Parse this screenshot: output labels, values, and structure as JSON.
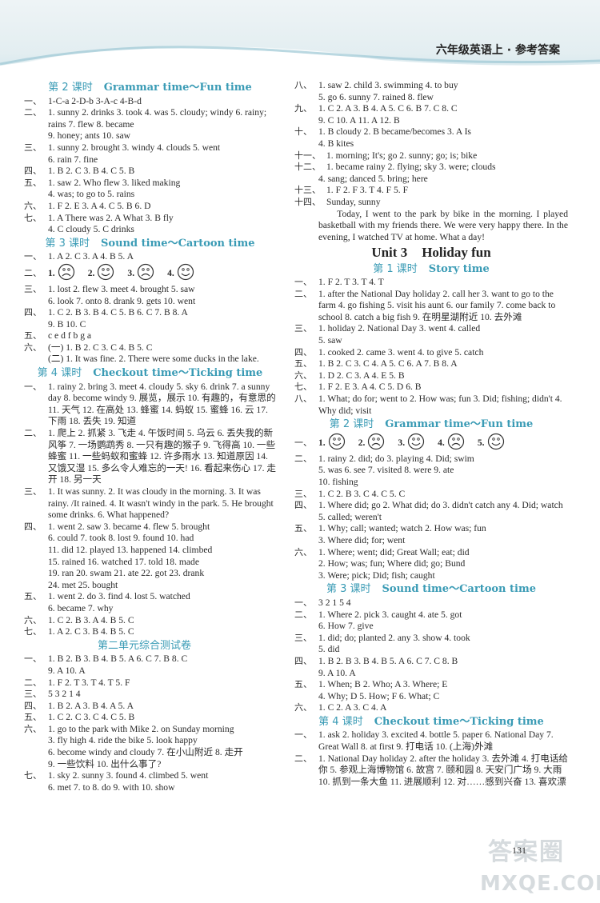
{
  "header": {
    "title": "六年级英语上 · 参考答案"
  },
  "left": [
    {
      "type": "section",
      "cn": "第 2 课时",
      "en": "Grammar time～Fun time"
    },
    {
      "pre": "一、",
      "text": "1-C-a   2-D-b   3-A-c   4-B-d"
    },
    {
      "pre": "二、",
      "text": "1. sunny   2. drinks   3. took   4. was   5. cloudy; windy   6. rainy; rains   7. flew   8. became"
    },
    {
      "pre": "",
      "text": "9. honey; ants   10. saw"
    },
    {
      "pre": "三、",
      "text": "1. sunny   2. brought   3. windy   4. clouds   5. went"
    },
    {
      "pre": "",
      "text": "6. rain   7. fine"
    },
    {
      "pre": "四、",
      "text": "1. B   2. C   3. B   4. C   5. B"
    },
    {
      "pre": "五、",
      "text": "1. saw   2. Who flew   3. liked making"
    },
    {
      "pre": "",
      "text": "4. was; to go to   5. rains"
    },
    {
      "pre": "六、",
      "text": "1. F   2. E   3. A   4. C   5. B   6. D"
    },
    {
      "pre": "七、",
      "text": "1. A   There was   2. A   What   3. B   fly"
    },
    {
      "pre": "",
      "text": "4. C   cloudy   5. C   drinks"
    },
    {
      "type": "section",
      "cn": "第 3 课时",
      "en": "Sound time～Cartoon time"
    },
    {
      "pre": "一、",
      "text": "1. A   2. C   3. A   4. B   5. A"
    },
    {
      "type": "faces",
      "pre": "二、",
      "faces": [
        {
          "n": "1.",
          "mood": "sad"
        },
        {
          "n": "2.",
          "mood": "happy"
        },
        {
          "n": "3.",
          "mood": "sad"
        },
        {
          "n": "4.",
          "mood": "happy"
        }
      ]
    },
    {
      "pre": "三、",
      "text": "1. lost   2. flew   3. meet   4. brought   5. saw"
    },
    {
      "pre": "",
      "text": "6. look   7. onto   8. drank   9. gets   10. went"
    },
    {
      "pre": "四、",
      "text": "1. C   2. B   3. B   4. C   5. B   6. C   7. B   8. A"
    },
    {
      "pre": "",
      "text": "9. B   10. C"
    },
    {
      "pre": "五、",
      "text": "c e d f b g a"
    },
    {
      "pre": "六、",
      "text": "(一) 1. B   2. C   3. C   4. B   5. C"
    },
    {
      "pre": "",
      "text": "(二) 1. It was fine.   2. There were some ducks in the lake."
    },
    {
      "type": "section",
      "cn": "第 4 课时",
      "en": "Checkout time～Ticking time"
    },
    {
      "pre": "一、",
      "text": "1. rainy   2. bring   3. meet   4. cloudy   5. sky   6. drink   7. a sunny day   8. become windy   9. 展览，展示   10. 有趣的，有意思的   11. 天气   12. 在高处   13. 蜂蜜   14. 蚂蚁   15. 蜜蜂   16. 云   17. 下雨   18. 丢失   19. 知道"
    },
    {
      "pre": "二、",
      "text": "1. 爬上   2. 抓紧   3. 飞走   4. 午饭时间   5. 乌云   6. 丢失我的新风筝   7. 一场鹦鹉秀   8. 一只有趣的猴子   9. 飞得高   10. 一些蜂蜜   11. 一些蚂蚁和蜜蜂   12. 许多雨水   13. 知道原因   14. 又饿又湿   15. 多么令人难忘的一天!   16. 看起来伤心   17. 走开   18. 另一天"
    },
    {
      "pre": "三、",
      "text": "1. It was sunny.   2. It was cloudy in the morning.   3. It was rainy. /It rained.   4. It wasn't windy in the park.   5. He brought some drinks.   6. What happened?"
    },
    {
      "pre": "四、",
      "text": "1. went   2. saw   3. became   4. flew   5. brought"
    },
    {
      "pre": "",
      "text": "6. could   7. took   8. lost   9. found   10. had"
    },
    {
      "pre": "",
      "text": "11. did   12. played   13. happened   14. climbed"
    },
    {
      "pre": "",
      "text": "15. rained   16. watched   17. told   18. made"
    },
    {
      "pre": "",
      "text": "19. ran   20. swam   21. ate   22. got   23. drank"
    },
    {
      "pre": "",
      "text": "24. met   25. bought"
    },
    {
      "pre": "五、",
      "text": "1. went   2. do   3. find   4. lost   5. watched"
    },
    {
      "pre": "",
      "text": "6. became   7. why"
    },
    {
      "pre": "六、",
      "text": "1. C   2. B   3. A   4. B   5. C"
    },
    {
      "pre": "七、",
      "text": "1. A   2. C   3. B   4. B   5. C"
    },
    {
      "type": "section",
      "cn": "第二单元综合测试卷",
      "en": ""
    },
    {
      "pre": "一、",
      "text": "1. B   2. B   3. B   4. B   5. A   6. C   7. B   8. C"
    },
    {
      "pre": "",
      "text": "9. A   10. A"
    },
    {
      "pre": "二、",
      "text": "1. F   2. T   3. T   4. T   5. F"
    },
    {
      "pre": "三、",
      "text": "5   3   2   1   4"
    },
    {
      "pre": "四、",
      "text": "1. B   2. A   3. B   4. A   5. A"
    },
    {
      "pre": "五、",
      "text": "1. C   2. C   3. C   4. C   5. B"
    },
    {
      "pre": "六、",
      "text": "1. go to the park with Mike   2. on Sunday morning"
    },
    {
      "pre": "",
      "text": "3. fly high   4. ride the bike   5. look happy"
    },
    {
      "pre": "",
      "text": "6. become windy and cloudy   7. 在小山附近   8. 走开"
    },
    {
      "pre": "",
      "text": "9. 一些饮料   10. 出什么事了?"
    },
    {
      "pre": "七、",
      "text": "1. sky   2. sunny   3. found   4. climbed   5. went"
    },
    {
      "pre": "",
      "text": "6. met   7. to   8. do   9. with   10. show"
    }
  ],
  "right": [
    {
      "pre": "八、",
      "text": "1. saw   2. child   3. swimming   4. to buy"
    },
    {
      "pre": "",
      "text": "5. go   6. sunny   7. rained   8. flew"
    },
    {
      "pre": "九、",
      "text": "1. C   2. A   3. B   4. A   5. C   6. B   7. C   8. C"
    },
    {
      "pre": "",
      "text": "9. C   10. A   11. A   12. B"
    },
    {
      "pre": "十、",
      "text": "1. B   cloudy   2. B   became/becomes   3. A   Is"
    },
    {
      "pre": "",
      "text": "4. B   kites"
    },
    {
      "pre": "十一、",
      "text": "1. morning; It's; go   2. sunny; go; is; bike"
    },
    {
      "pre": "十二、",
      "text": "1. became rainy   2. flying; sky   3. were; clouds"
    },
    {
      "pre": "",
      "text": "4. sang; danced   5. bring; here"
    },
    {
      "pre": "十三、",
      "text": "1. F   2. F   3. T   4. F   5. F"
    },
    {
      "pre": "十四、",
      "text": "Sunday, sunny"
    },
    {
      "type": "para",
      "text": "Today, I went to the park by bike in the morning. I played basketball with my friends there. We were very happy there. In the evening, I watched TV at home. What a day!"
    },
    {
      "type": "unit",
      "a": "Unit 3",
      "b": "Holiday fun"
    },
    {
      "type": "section",
      "cn": "第 1 课时",
      "en": "Story time"
    },
    {
      "pre": "一、",
      "text": "1. F   2. T   3. T   4. T"
    },
    {
      "pre": "二、",
      "text": "1. after the National Day holiday   2. call her   3. want to go to the farm   4. go fishing   5. visit his aunt   6. our family   7. come back to school   8. catch a big fish   9. 在明星湖附近   10. 去外滩"
    },
    {
      "pre": "三、",
      "text": "1. holiday   2. National Day   3. went   4. called"
    },
    {
      "pre": "",
      "text": "5. saw"
    },
    {
      "pre": "四、",
      "text": "1. cooked   2. came   3. went   4. to give   5. catch"
    },
    {
      "pre": "五、",
      "text": "1. B   2. C   3. C   4. A   5. C   6. A   7. B   8. A"
    },
    {
      "pre": "六、",
      "text": "1. D   2. C   3. A   4. E   5. B"
    },
    {
      "pre": "七、",
      "text": "1. F   2. E   3. A   4. C   5. D   6. B"
    },
    {
      "pre": "八、",
      "text": "1. What; do for; went to   2. How was; fun   3. Did; fishing; didn't   4. Why did; visit"
    },
    {
      "type": "section",
      "cn": "第 2 课时",
      "en": "Grammar time～Fun time"
    },
    {
      "type": "faces",
      "pre": "一、",
      "faces": [
        {
          "n": "1.",
          "mood": "happy"
        },
        {
          "n": "2.",
          "mood": "sad"
        },
        {
          "n": "3.",
          "mood": "happy"
        },
        {
          "n": "4.",
          "mood": "sad"
        },
        {
          "n": "5.",
          "mood": "happy"
        }
      ]
    },
    {
      "pre": "二、",
      "text": "1. rainy   2. did; do   3. playing   4. Did; swim"
    },
    {
      "pre": "",
      "text": "5. was   6. see   7. visited   8. were   9. ate"
    },
    {
      "pre": "",
      "text": "10. fishing"
    },
    {
      "pre": "三、",
      "text": "1. C   2. B   3. C   4. C   5. C"
    },
    {
      "pre": "四、",
      "text": "1. Where did; go   2. What did; do   3. didn't catch any   4. Did; watch   5. called; weren't"
    },
    {
      "pre": "五、",
      "text": "1. Why; call; wanted; watch   2. How was; fun"
    },
    {
      "pre": "",
      "text": "3. Where did; for; went"
    },
    {
      "pre": "六、",
      "text": "1. Where; went; did; Great Wall; eat; did"
    },
    {
      "pre": "",
      "text": "2. How; was; fun; Where did; go; Bund"
    },
    {
      "pre": "",
      "text": "3. Were; pick; Did; fish; caught"
    },
    {
      "type": "section",
      "cn": "第 3 课时",
      "en": "Sound time～Cartoon time"
    },
    {
      "pre": "一、",
      "text": "3   2   1   5   4"
    },
    {
      "pre": "二、",
      "text": "1. Where   2. pick   3. caught   4. ate   5. got"
    },
    {
      "pre": "",
      "text": "6. How   7. give"
    },
    {
      "pre": "三、",
      "text": "1. did; do; planted   2. any   3. show   4. took"
    },
    {
      "pre": "",
      "text": "5. did"
    },
    {
      "pre": "四、",
      "text": "1. B   2. B   3. B   4. B   5. A   6. C   7. C   8. B"
    },
    {
      "pre": "",
      "text": "9. A   10. A"
    },
    {
      "pre": "五、",
      "text": "1. When; B   2. Who; A   3. Where; E"
    },
    {
      "pre": "",
      "text": "4. Why; D   5. How; F   6. What; C"
    },
    {
      "pre": "六、",
      "text": "1. C   2. A   3. C   4. A"
    },
    {
      "type": "section",
      "cn": "第 4 课时",
      "en": "Checkout time～Ticking time"
    },
    {
      "pre": "一、",
      "text": "1. ask   2. holiday   3. excited   4. bottle   5. paper   6. National Day   7. Great Wall   8. at first   9. 打电话   10. (上海)外滩"
    },
    {
      "pre": "二、",
      "text": "1. National Day holiday   2. after the holiday   3. 去外滩   4. 打电话给你   5. 参观上海博物馆   6. 故宫   7. 颐和园   8. 天安门广场   9. 大雨   10. 抓到一条大鱼   11. 进展顺利   12. 对……感到兴奋   13. 喜欢漂"
    }
  ],
  "footer": {
    "page_number": "131",
    "watermark_top": "答案圈",
    "watermark_bottom": "MXQE.COM"
  }
}
